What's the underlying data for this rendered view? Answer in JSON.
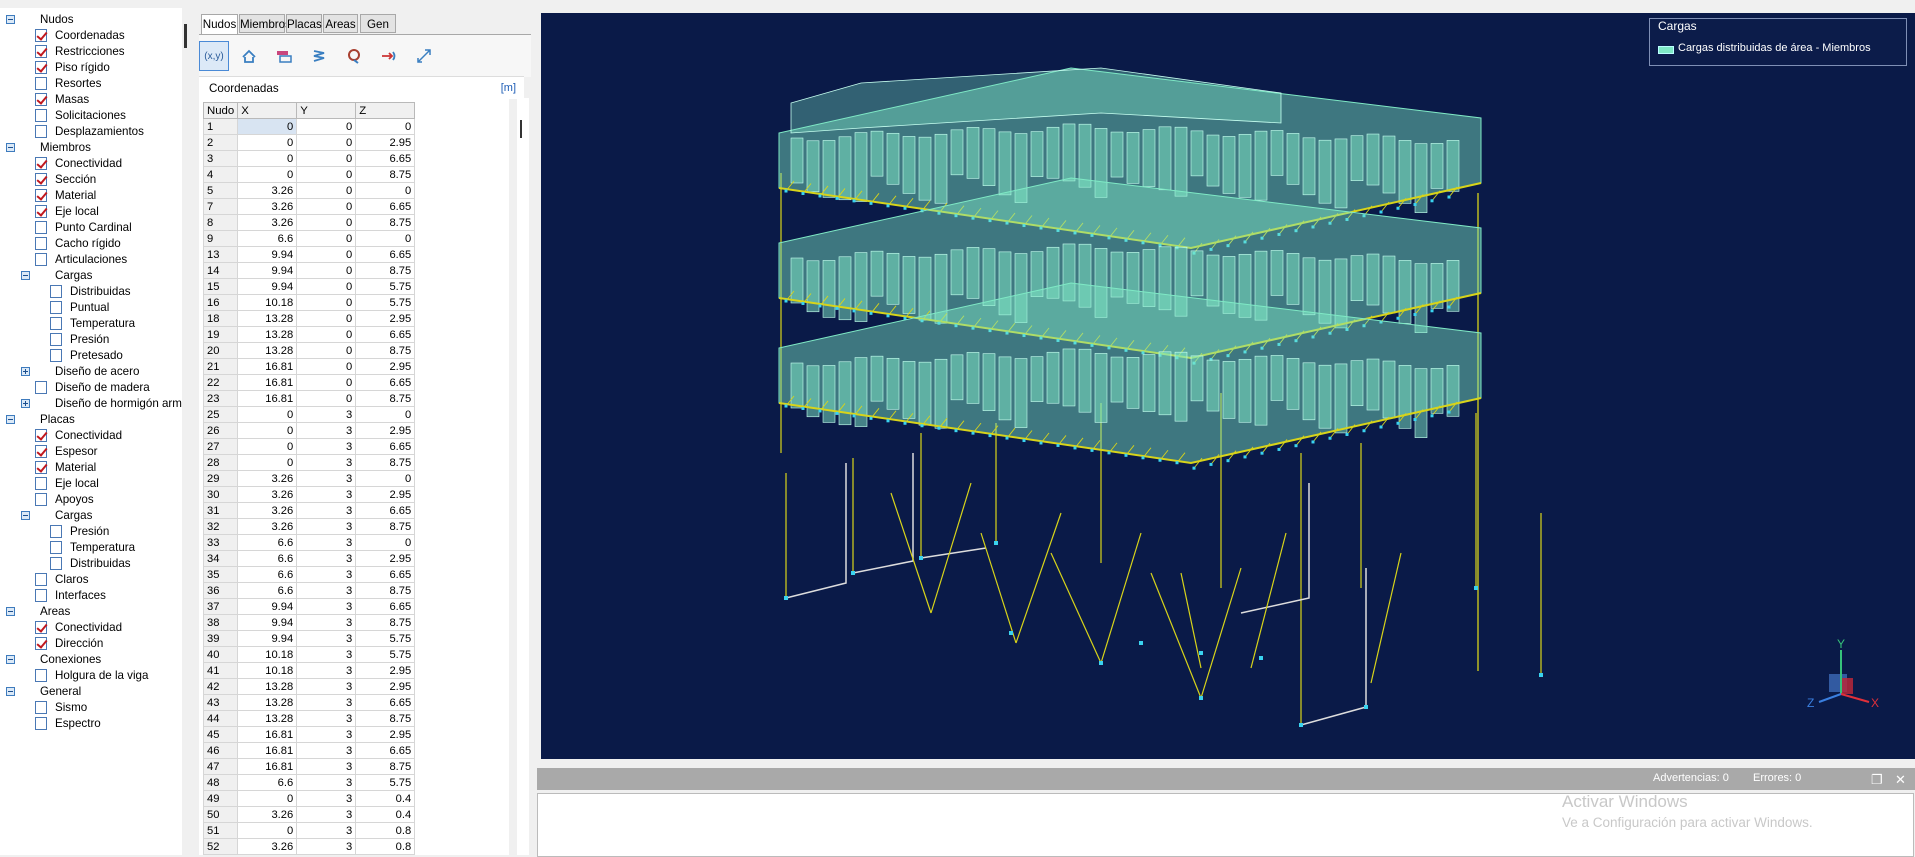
{
  "tree": {
    "items": [
      {
        "label": "Nudos",
        "level": 0,
        "toggle": "minus"
      },
      {
        "label": "Coordenadas",
        "level": 1,
        "check": true
      },
      {
        "label": "Restricciones",
        "level": 1,
        "check": true
      },
      {
        "label": "Piso rígido",
        "level": 1,
        "check": true
      },
      {
        "label": "Resortes",
        "level": 1,
        "check": false
      },
      {
        "label": "Masas",
        "level": 1,
        "check": true
      },
      {
        "label": "Solicitaciones",
        "level": 1,
        "check": false
      },
      {
        "label": "Desplazamientos",
        "level": 1,
        "check": false
      },
      {
        "label": "Miembros",
        "level": 0,
        "toggle": "minus"
      },
      {
        "label": "Conectividad",
        "level": 1,
        "check": true
      },
      {
        "label": "Sección",
        "level": 1,
        "check": true
      },
      {
        "label": "Material",
        "level": 1,
        "check": true
      },
      {
        "label": "Eje local",
        "level": 1,
        "check": true
      },
      {
        "label": "Punto Cardinal",
        "level": 1,
        "check": false
      },
      {
        "label": "Cacho rígido",
        "level": 1,
        "check": false
      },
      {
        "label": "Articulaciones",
        "level": 1,
        "check": false
      },
      {
        "label": "Cargas",
        "level": 1,
        "toggle": "minus"
      },
      {
        "label": "Distribuidas",
        "level": 2,
        "check": false
      },
      {
        "label": "Puntual",
        "level": 2,
        "check": false
      },
      {
        "label": "Temperatura",
        "level": 2,
        "check": false
      },
      {
        "label": "Presión",
        "level": 2,
        "check": false
      },
      {
        "label": "Pretesado",
        "level": 2,
        "check": false
      },
      {
        "label": "Diseño de acero",
        "level": 1,
        "toggle": "plus"
      },
      {
        "label": "Diseño de madera",
        "level": 1,
        "check": false
      },
      {
        "label": "Diseño de hormigón arma",
        "level": 1,
        "toggle": "plus"
      },
      {
        "label": "Placas",
        "level": 0,
        "toggle": "minus"
      },
      {
        "label": "Conectividad",
        "level": 1,
        "check": true
      },
      {
        "label": "Espesor",
        "level": 1,
        "check": true
      },
      {
        "label": "Material",
        "level": 1,
        "check": true
      },
      {
        "label": "Eje local",
        "level": 1,
        "check": false
      },
      {
        "label": "Apoyos",
        "level": 1,
        "check": false
      },
      {
        "label": "Cargas",
        "level": 1,
        "toggle": "minus"
      },
      {
        "label": "Presión",
        "level": 2,
        "check": false
      },
      {
        "label": "Temperatura",
        "level": 2,
        "check": false
      },
      {
        "label": "Distribuidas",
        "level": 2,
        "check": false
      },
      {
        "label": "Claros",
        "level": 1,
        "check": false
      },
      {
        "label": "Interfaces",
        "level": 1,
        "check": false
      },
      {
        "label": "Areas",
        "level": 0,
        "toggle": "minus"
      },
      {
        "label": "Conectividad",
        "level": 1,
        "check": true
      },
      {
        "label": "Dirección",
        "level": 1,
        "check": true
      },
      {
        "label": "Conexiones",
        "level": 0,
        "toggle": "minus"
      },
      {
        "label": "Holgura de la viga",
        "level": 1,
        "check": false
      },
      {
        "label": "General",
        "level": 0,
        "toggle": "minus"
      },
      {
        "label": "Sismo",
        "level": 1,
        "check": false
      },
      {
        "label": "Espectro",
        "level": 1,
        "check": false
      }
    ]
  },
  "tabs": [
    "Nudos",
    "Miembros",
    "Placas",
    "Areas",
    "Gen"
  ],
  "active_tab": "Nudos",
  "toolbar": {
    "coord_tool_label": "(x,y)",
    "icons": [
      "coordinates-icon",
      "restraints-icon",
      "rigid-floor-icon",
      "springs-icon",
      "masses-icon",
      "loads-icon",
      "displacements-icon"
    ]
  },
  "coordinates": {
    "title": "Coordenadas",
    "unit": "[m]",
    "columns": [
      "Nudo",
      "X",
      "Y",
      "Z"
    ],
    "rows": [
      [
        "1",
        "0",
        "0",
        "0"
      ],
      [
        "2",
        "0",
        "0",
        "2.95"
      ],
      [
        "3",
        "0",
        "0",
        "6.65"
      ],
      [
        "4",
        "0",
        "0",
        "8.75"
      ],
      [
        "5",
        "3.26",
        "0",
        "0"
      ],
      [
        "7",
        "3.26",
        "0",
        "6.65"
      ],
      [
        "8",
        "3.26",
        "0",
        "8.75"
      ],
      [
        "9",
        "6.6",
        "0",
        "0"
      ],
      [
        "13",
        "9.94",
        "0",
        "6.65"
      ],
      [
        "14",
        "9.94",
        "0",
        "8.75"
      ],
      [
        "15",
        "9.94",
        "0",
        "5.75"
      ],
      [
        "16",
        "10.18",
        "0",
        "5.75"
      ],
      [
        "18",
        "13.28",
        "0",
        "2.95"
      ],
      [
        "19",
        "13.28",
        "0",
        "6.65"
      ],
      [
        "20",
        "13.28",
        "0",
        "8.75"
      ],
      [
        "21",
        "16.81",
        "0",
        "2.95"
      ],
      [
        "22",
        "16.81",
        "0",
        "6.65"
      ],
      [
        "23",
        "16.81",
        "0",
        "8.75"
      ],
      [
        "25",
        "0",
        "3",
        "0"
      ],
      [
        "26",
        "0",
        "3",
        "2.95"
      ],
      [
        "27",
        "0",
        "3",
        "6.65"
      ],
      [
        "28",
        "0",
        "3",
        "8.75"
      ],
      [
        "29",
        "3.26",
        "3",
        "0"
      ],
      [
        "30",
        "3.26",
        "3",
        "2.95"
      ],
      [
        "31",
        "3.26",
        "3",
        "6.65"
      ],
      [
        "32",
        "3.26",
        "3",
        "8.75"
      ],
      [
        "33",
        "6.6",
        "3",
        "0"
      ],
      [
        "34",
        "6.6",
        "3",
        "2.95"
      ],
      [
        "35",
        "6.6",
        "3",
        "6.65"
      ],
      [
        "36",
        "6.6",
        "3",
        "8.75"
      ],
      [
        "37",
        "9.94",
        "3",
        "6.65"
      ],
      [
        "38",
        "9.94",
        "3",
        "8.75"
      ],
      [
        "39",
        "9.94",
        "3",
        "5.75"
      ],
      [
        "40",
        "10.18",
        "3",
        "5.75"
      ],
      [
        "41",
        "10.18",
        "3",
        "2.95"
      ],
      [
        "42",
        "13.28",
        "3",
        "2.95"
      ],
      [
        "43",
        "13.28",
        "3",
        "6.65"
      ],
      [
        "44",
        "13.28",
        "3",
        "8.75"
      ],
      [
        "45",
        "16.81",
        "3",
        "2.95"
      ],
      [
        "46",
        "16.81",
        "3",
        "6.65"
      ],
      [
        "47",
        "16.81",
        "3",
        "8.75"
      ],
      [
        "48",
        "6.6",
        "3",
        "5.75"
      ],
      [
        "49",
        "0",
        "3",
        "0.4"
      ],
      [
        "50",
        "3.26",
        "3",
        "0.4"
      ],
      [
        "51",
        "0",
        "3",
        "0.8"
      ],
      [
        "52",
        "3.26",
        "3",
        "0.8"
      ]
    ]
  },
  "legend": {
    "title": "Cargas",
    "item": "Cargas distribuidas de área - Miembros",
    "color": "#7fe9c5"
  },
  "view": {
    "background": "#0a1a48",
    "axes": {
      "x": "X",
      "y": "Y",
      "z": "Z"
    }
  },
  "messages": {
    "warnings": "Advertencias: 0",
    "errors": "Errores: 0"
  },
  "watermark": {
    "line1": "Activar Windows",
    "line2": "Ve a Configuración para activar Windows."
  }
}
